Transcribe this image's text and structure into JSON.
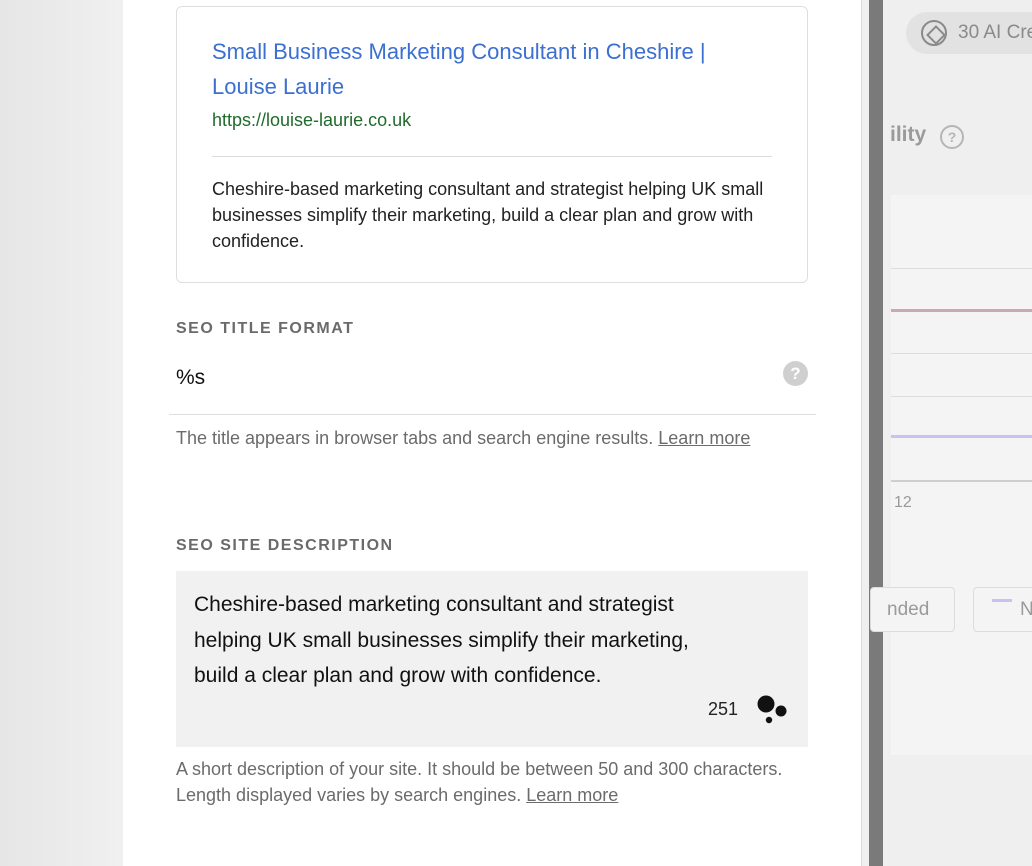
{
  "preview": {
    "title": "Small Business Marketing Consultant in Cheshire | Louise Laurie",
    "url": "https://louise-laurie.co.uk",
    "description": "Cheshire-based marketing consultant and strategist helping UK small businesses simplify their marketing, build a clear plan and grow with confidence."
  },
  "seo_title": {
    "label": "SEO TITLE FORMAT",
    "value": "%s",
    "help_icon": "question-circle-icon",
    "help_text": "The title appears in browser tabs and search engine results.",
    "learn_more": "Learn more"
  },
  "seo_description": {
    "label": "SEO SITE DESCRIPTION",
    "value": "Cheshire-based marketing consultant and strategist helping UK small businesses simplify their marketing, build a clear plan and grow with confidence.",
    "char_count": "251",
    "ai_icon": "ai-dots-icon",
    "help_text": "A short description of your site. It should be between 50 and 300 characters. Length displayed varies by search engines.",
    "learn_more": "Learn more"
  },
  "background_panel": {
    "credits_text": "30 AI Cre",
    "credits_icon": "compass-icon",
    "section_title_fragment": "ility",
    "help_icon_glyph": "?",
    "tick_label": "12",
    "legend_1": "nded",
    "legend_2": "N",
    "series_colors": [
      "#c9a9b6",
      "#c8c2ee"
    ]
  }
}
